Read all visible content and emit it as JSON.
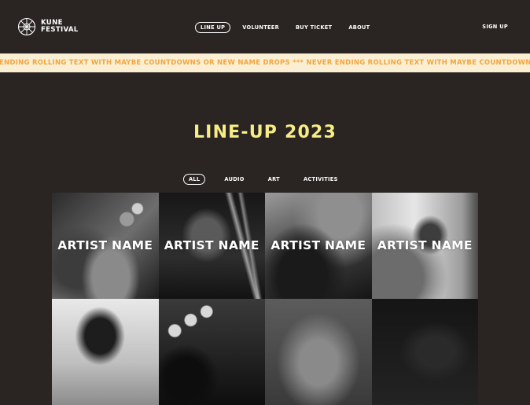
{
  "brand": {
    "line1": "KUNE",
    "line2": "FESTIVAL"
  },
  "nav": {
    "items": [
      {
        "label": "LINE UP",
        "active": true
      },
      {
        "label": "VOLUNTEER",
        "active": false
      },
      {
        "label": "BUY TICKET",
        "active": false
      },
      {
        "label": "ABOUT",
        "active": false
      }
    ],
    "signup": "SIGN UP"
  },
  "ticker": {
    "text": "ENDING ROLLING TEXT WITH MAYBE COUNTDOWNS OR NEW NAME DROPS *** NEVER ENDING ROLLING TEXT WITH MAYBE COUNTDOWNS OR NEW NAME",
    "color": "#f0a541",
    "background": "#fbefd3"
  },
  "page": {
    "title": "LINE-UP 2023",
    "title_color": "#f6ed86"
  },
  "filters": [
    {
      "label": "ALL",
      "active": true
    },
    {
      "label": "AUDIO",
      "active": false
    },
    {
      "label": "ART",
      "active": false
    },
    {
      "label": "ACTIVITIES",
      "active": false
    }
  ],
  "artists": [
    {
      "name": "ARTIST NAME"
    },
    {
      "name": "ARTIST NAME"
    },
    {
      "name": "ARTIST NAME"
    },
    {
      "name": "ARTIST NAME"
    },
    {
      "name": ""
    },
    {
      "name": ""
    },
    {
      "name": ""
    },
    {
      "name": ""
    }
  ]
}
